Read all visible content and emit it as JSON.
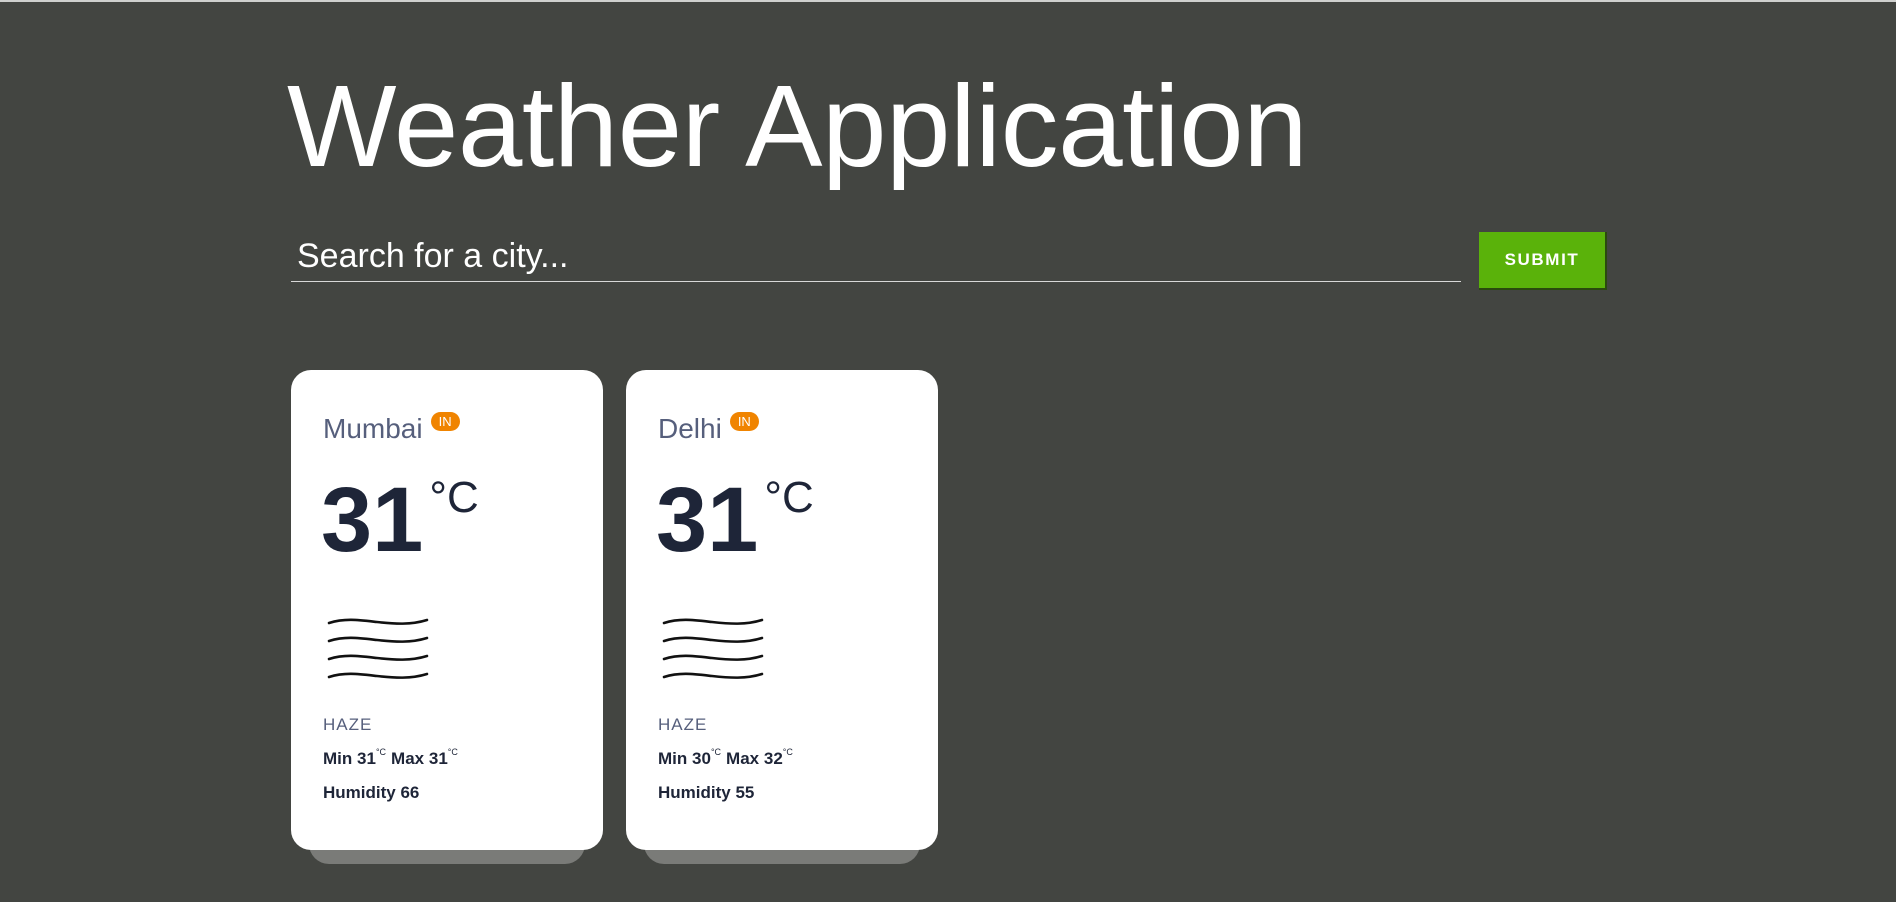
{
  "app": {
    "title": "Weather Application"
  },
  "search": {
    "placeholder": "Search for a city...",
    "value": "",
    "submit_label": "SUBMIT"
  },
  "colors": {
    "background": "#434541",
    "card": "#ffffff",
    "submit": "#5ab20a",
    "badge": "#f08400",
    "city_text": "#565f7c",
    "dark_text": "#1e2538"
  },
  "cards": [
    {
      "city": "Mumbai",
      "country": "IN",
      "temp": "31",
      "unit": "°C",
      "icon": "haze-icon",
      "condition": "HAZE",
      "min_label": "Min",
      "min": "31",
      "max_label": "Max",
      "max": "31",
      "small_unit": "°C",
      "humidity_label": "Humidity",
      "humidity": "66"
    },
    {
      "city": "Delhi",
      "country": "IN",
      "temp": "31",
      "unit": "°C",
      "icon": "haze-icon",
      "condition": "HAZE",
      "min_label": "Min",
      "min": "30",
      "max_label": "Max",
      "max": "32",
      "small_unit": "°C",
      "humidity_label": "Humidity",
      "humidity": "55"
    }
  ]
}
